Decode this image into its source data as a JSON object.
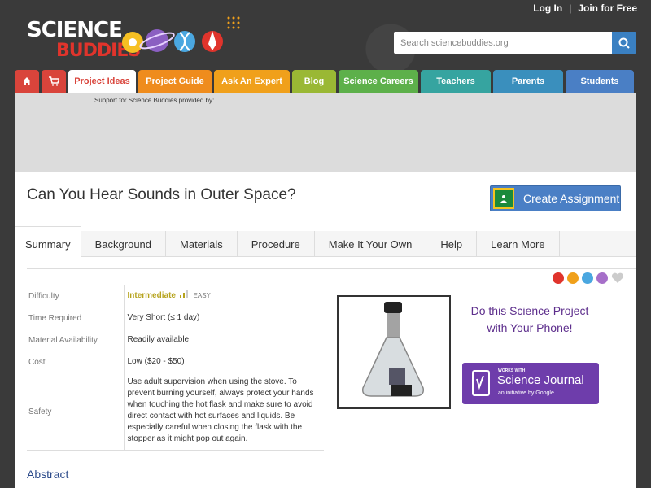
{
  "header": {
    "login_label": "Log In",
    "separator": "|",
    "join_label": "Join for Free",
    "logo_line1": "SCIENCE",
    "logo_line2": "BUDDIES",
    "search_placeholder": "Search sciencebuddies.org"
  },
  "nav": {
    "tabs": [
      {
        "label": "Project Ideas",
        "color": "#ffffff",
        "active": true
      },
      {
        "label": "Project Guide",
        "color": "#ef8c1d"
      },
      {
        "label": "Ask An Expert",
        "color": "#f0a01b"
      },
      {
        "label": "Blog",
        "color": "#9ab834"
      },
      {
        "label": "Science Careers",
        "color": "#5db04a"
      },
      {
        "label": "Teachers",
        "color": "#36a4a0"
      },
      {
        "label": "Parents",
        "color": "#3a8fbd"
      },
      {
        "label": "Students",
        "color": "#4a7fc5"
      }
    ]
  },
  "ad": {
    "support_text": "Support for Science Buddies provided by:"
  },
  "page": {
    "title": "Can You Hear Sounds in Outer Space?",
    "create_assignment": "Create Assignment"
  },
  "tabs": [
    "Summary",
    "Background",
    "Materials",
    "Procedure",
    "Make It Your Own",
    "Help",
    "Learn More"
  ],
  "summary": {
    "difficulty_label": "Difficulty",
    "difficulty_value": "Intermediate",
    "difficulty_sub": "EASY",
    "time_label": "Time Required",
    "time_value": "Very Short (≤ 1 day)",
    "material_label": "Material Availability",
    "material_value": "Readily available",
    "cost_label": "Cost",
    "cost_value": "Low ($20 - $50)",
    "safety_label": "Safety",
    "safety_value": "Use adult supervision when using the stove. To prevent burning yourself, always protect your hands when touching the hot flask and make sure to avoid direct contact with hot surfaces and liquids. Be especially careful when closing the flask with the stopper as it might pop out again."
  },
  "phone": {
    "text": "Do this Science Project with Your Phone!",
    "badge_works": "WORKS WITH",
    "badge_title": "Science Journal",
    "badge_init": "an initiative by Google"
  },
  "abstract_heading": "Abstract"
}
